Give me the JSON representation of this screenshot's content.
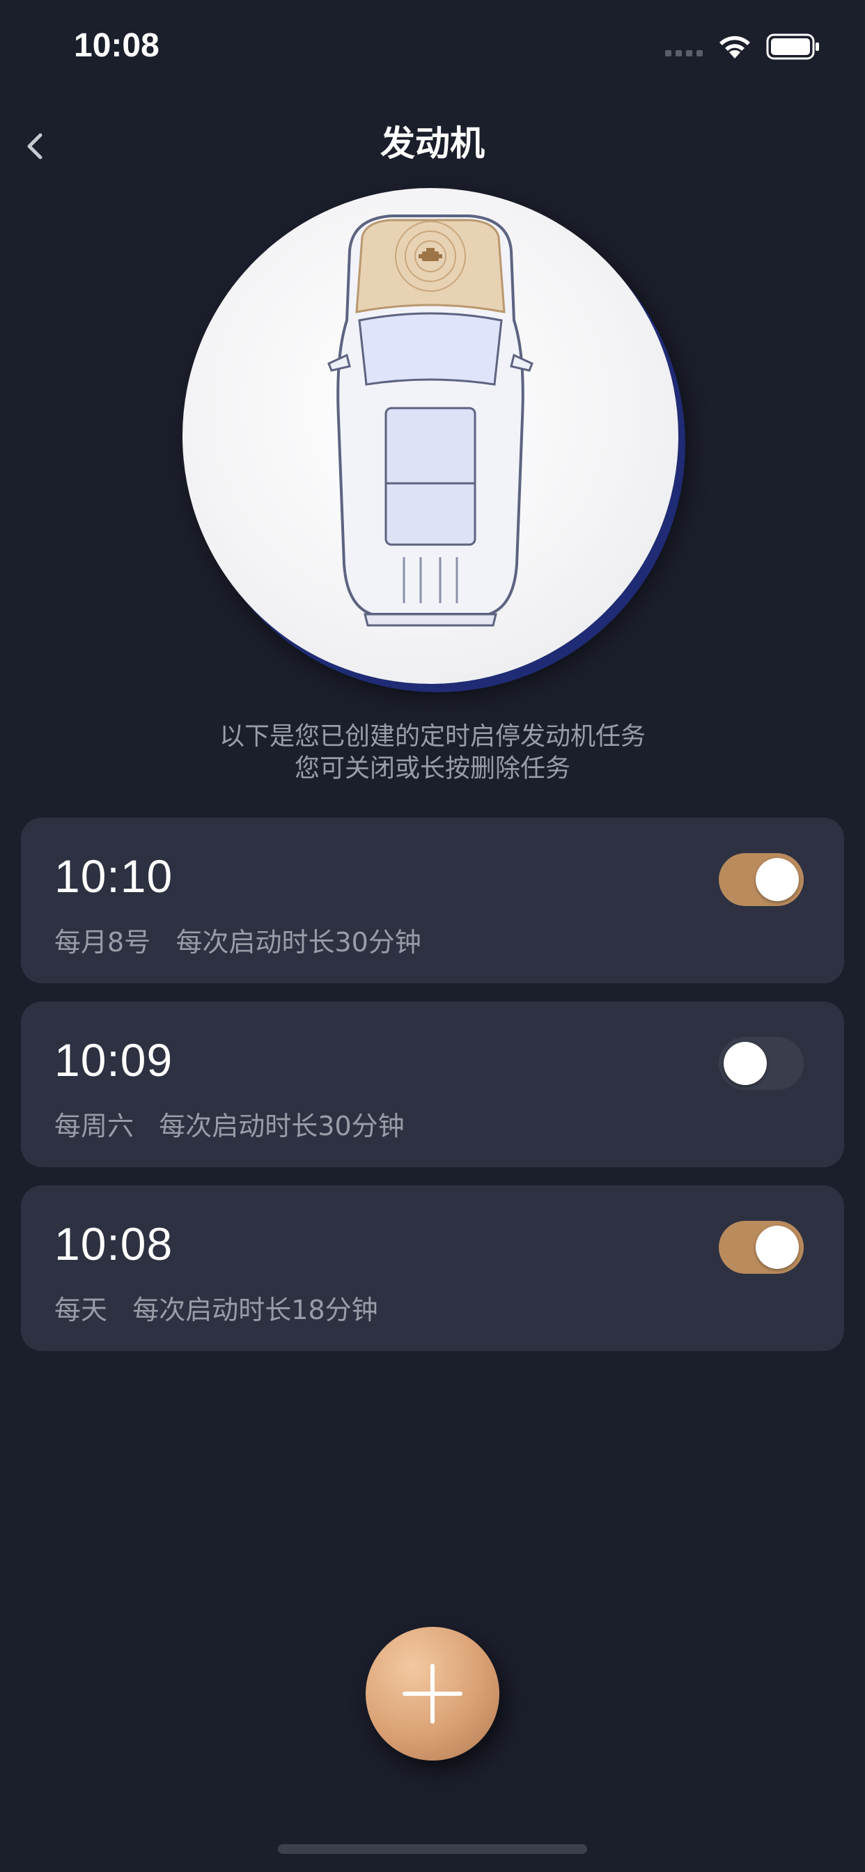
{
  "status_bar": {
    "time": "10:08"
  },
  "header": {
    "title": "发动机",
    "back_icon": "chevron-left-icon"
  },
  "intro": {
    "line1": "以下是您已创建的定时启停发动机任务",
    "line2": "您可关闭或长按删除任务"
  },
  "tasks": [
    {
      "time": "10:10",
      "repeat": "每月8号",
      "duration": "每次启动时长30分钟",
      "enabled": true
    },
    {
      "time": "10:09",
      "repeat": "每周六",
      "duration": "每次启动时长30分钟",
      "enabled": false
    },
    {
      "time": "10:08",
      "repeat": "每天",
      "duration": "每次启动时长18分钟",
      "enabled": true
    }
  ],
  "colors": {
    "background": "#1b1e2b",
    "card": "#2d3142",
    "accent": "#b98b5d",
    "secondary_text": "#9a9da8"
  },
  "add_button": {
    "icon": "plus-icon"
  }
}
